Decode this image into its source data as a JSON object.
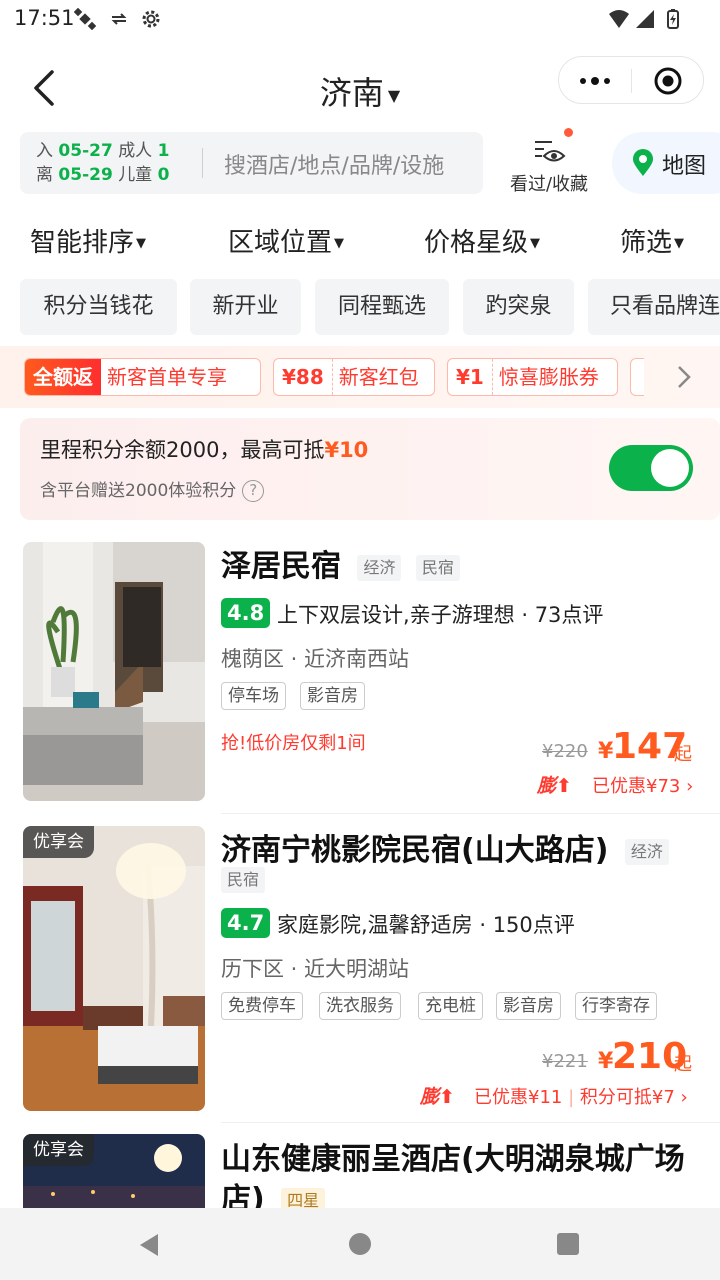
{
  "status": {
    "time": "17:51"
  },
  "nav": {
    "title": "济南"
  },
  "search": {
    "checkin_label": "入",
    "checkin_date": "05-27",
    "checkout_label": "离",
    "checkout_date": "05-29",
    "adults_label": "成人",
    "adults": "1",
    "children_label": "儿童",
    "children": "0",
    "placeholder": "搜酒店/地点/品牌/设施",
    "favorites_label": "看过/收藏",
    "map_label": "地图"
  },
  "filters": [
    {
      "label": "智能排序"
    },
    {
      "label": "区域位置"
    },
    {
      "label": "价格星级"
    },
    {
      "label": "筛选"
    }
  ],
  "chips": [
    {
      "label": "积分当钱花"
    },
    {
      "label": "新开业"
    },
    {
      "label": "同程甄选"
    },
    {
      "label": "趵突泉"
    },
    {
      "label": "只看品牌连锁"
    }
  ],
  "promos": [
    {
      "tag": "全额返",
      "text": "新客首单专享"
    },
    {
      "tag": "¥88",
      "text": "新客红包"
    },
    {
      "tag": "¥1",
      "text": "惊喜膨胀券"
    }
  ],
  "points": {
    "main_text": "里程积分余额2000，最高可抵",
    "main_amount": "¥10",
    "sub_text": "含平台赠送2000体验积分",
    "qmark": "?",
    "toggle_on": true,
    "toggle_color": "#0bb14a"
  },
  "hotels": [
    {
      "name": "泽居民宿",
      "tags": [
        "经济",
        "民宿"
      ],
      "score": "4.8",
      "review": "上下双层设计,亲子游理想 · 73点评",
      "location": "槐荫区 · 近济南西站",
      "facilities": [
        "停车场",
        "影音房"
      ],
      "urgent": "抢!低价房仅剩1间",
      "old_price": "¥220",
      "yen": "¥",
      "price": "147",
      "qi": "起",
      "peng": "膨",
      "discount": "已优惠¥73",
      "discount_extra": ""
    },
    {
      "badge": "优享会",
      "name": "济南宁桃影院民宿(山大路店)",
      "tags": [
        "经济",
        "民宿"
      ],
      "score": "4.7",
      "review": "家庭影院,温馨舒适房 · 150点评",
      "location": "历下区 · 近大明湖站",
      "facilities": [
        "免费停车",
        "洗衣服务",
        "充电桩",
        "影音房",
        "行李寄存"
      ],
      "old_price": "¥221",
      "yen": "¥",
      "price": "210",
      "qi": "起",
      "peng": "膨",
      "discount": "已优惠¥11",
      "discount_extra": "积分可抵¥7"
    },
    {
      "badge": "优享会",
      "name": "山东健康丽呈酒店(大明湖泉城广场店)",
      "tags": [
        "四星"
      ]
    }
  ],
  "colors": {
    "brand_green": "#0bb14a",
    "price_orange": "#ff5a1f",
    "promo_red": "#ff3b30"
  }
}
